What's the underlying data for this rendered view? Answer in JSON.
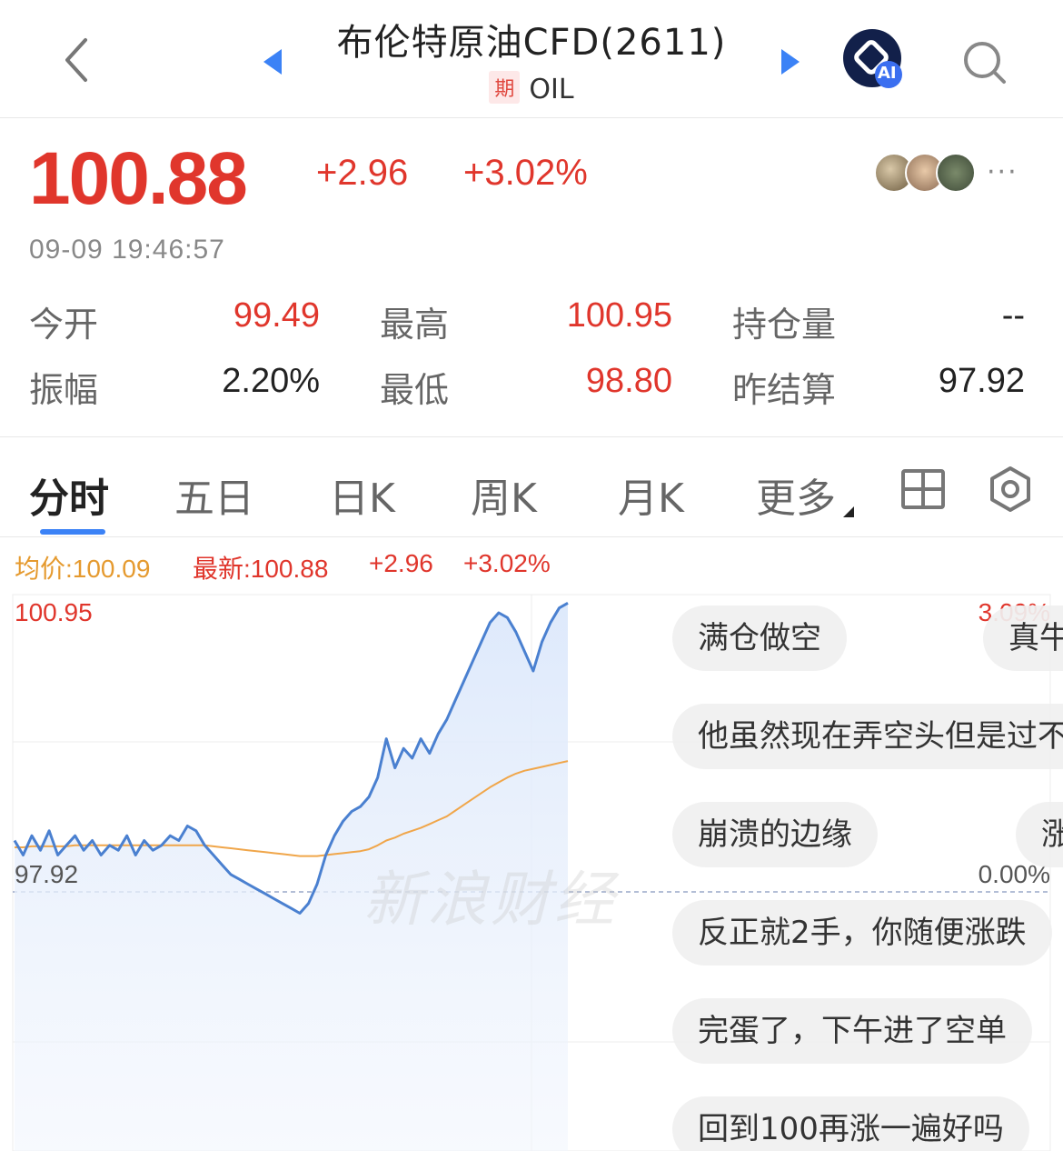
{
  "header": {
    "title": "布伦特原油CFD(2611)",
    "badge": "期",
    "symbol": "OIL",
    "ai_label": "AI"
  },
  "quote": {
    "price": "100.88",
    "change": "+2.96",
    "change_pct": "+3.02%",
    "timestamp": "09-09 19:46:57",
    "more": "···"
  },
  "stats": [
    {
      "label": "今开",
      "value": "99.49",
      "color": "#e0362c"
    },
    {
      "label": "最高",
      "value": "100.95",
      "color": "#e0362c"
    },
    {
      "label": "持仓量",
      "value": "--",
      "color": "#222222"
    },
    {
      "label": "振幅",
      "value": "2.20%",
      "color": "#222222"
    },
    {
      "label": "最低",
      "value": "98.80",
      "color": "#e0362c"
    },
    {
      "label": "昨结算",
      "value": "97.92",
      "color": "#222222"
    }
  ],
  "tabs": [
    {
      "label": "分时",
      "active": true
    },
    {
      "label": "五日",
      "active": false
    },
    {
      "label": "日K",
      "active": false
    },
    {
      "label": "周K",
      "active": false
    },
    {
      "label": "月K",
      "active": false
    },
    {
      "label": "更多",
      "active": false
    }
  ],
  "legend": {
    "avg": "均价:100.09",
    "latest": "最新:100.88",
    "change": "+2.96",
    "change_pct": "+3.02%"
  },
  "chart_labels": {
    "high": "100.95",
    "high_pct": "3.09%",
    "base": "97.92",
    "base_pct": "0.00%"
  },
  "watermark": "新浪财经",
  "comments": [
    "满仓做空",
    "真牛",
    "他虽然现在弄空头但是过不",
    "崩溃的边缘",
    "涨",
    "反正就2手，你随便涨跌",
    "完蛋了，下午进了空单",
    "回到100再涨一遍好吗"
  ],
  "chart_data": {
    "type": "line",
    "series": [
      {
        "name": "最新",
        "color": "#4a80d0",
        "values": [
          98.45,
          98.3,
          98.5,
          98.35,
          98.55,
          98.3,
          98.4,
          98.5,
          98.35,
          98.45,
          98.3,
          98.4,
          98.35,
          98.5,
          98.3,
          98.45,
          98.35,
          98.4,
          98.5,
          98.45,
          98.6,
          98.55,
          98.4,
          98.3,
          98.2,
          98.1,
          98.05,
          98.0,
          97.95,
          97.9,
          97.85,
          97.8,
          97.75,
          97.7,
          97.8,
          98.0,
          98.3,
          98.5,
          98.65,
          98.75,
          98.8,
          98.9,
          99.1,
          99.5,
          99.2,
          99.4,
          99.3,
          99.5,
          99.35,
          99.55,
          99.7,
          99.9,
          100.1,
          100.3,
          100.5,
          100.7,
          100.8,
          100.75,
          100.6,
          100.4,
          100.2,
          100.5,
          100.7,
          100.85,
          100.9
        ]
      },
      {
        "name": "均价",
        "color": "#f0a64a",
        "values": [
          98.38,
          98.38,
          98.39,
          98.39,
          98.39,
          98.39,
          98.39,
          98.4,
          98.4,
          98.4,
          98.4,
          98.4,
          98.4,
          98.4,
          98.4,
          98.4,
          98.4,
          98.4,
          98.4,
          98.4,
          98.4,
          98.4,
          98.4,
          98.39,
          98.38,
          98.37,
          98.36,
          98.35,
          98.34,
          98.33,
          98.32,
          98.31,
          98.3,
          98.29,
          98.29,
          98.29,
          98.3,
          98.31,
          98.32,
          98.33,
          98.34,
          98.36,
          98.4,
          98.45,
          98.48,
          98.52,
          98.55,
          98.58,
          98.62,
          98.66,
          98.7,
          98.76,
          98.82,
          98.88,
          98.94,
          99.0,
          99.05,
          99.1,
          99.14,
          99.17,
          99.19,
          99.21,
          99.23,
          99.25,
          99.27
        ]
      }
    ],
    "ylim": [
      97.92,
      100.95
    ],
    "title": "",
    "xlabel": "",
    "ylabel": ""
  }
}
